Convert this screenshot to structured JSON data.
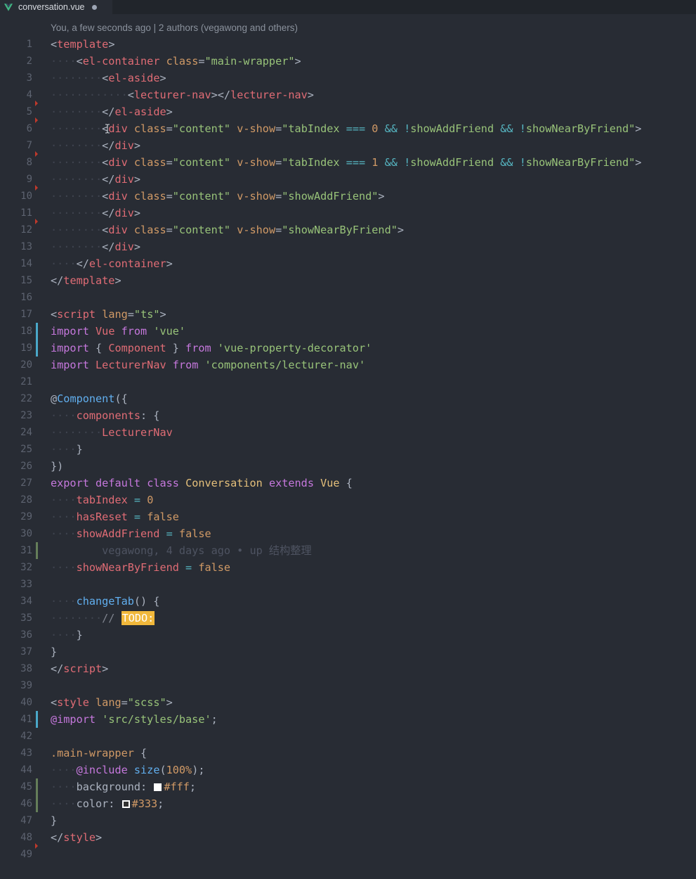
{
  "tab": {
    "filename": "conversation.vue",
    "icon": "vue-icon",
    "unsaved": true
  },
  "codelens": "You, a few seconds ago | 2 authors (vegawong and others)",
  "colors": {
    "background": "#282c34",
    "tag": "#e06c75",
    "attribute": "#d19a66",
    "string": "#98c379",
    "operator": "#56b6c2",
    "keyword": "#c678dd",
    "class": "#e5c07b",
    "function": "#61afef",
    "todo_highlight": "#f1b83b",
    "git_added": "#98c379",
    "git_modified": "#4aa8c9"
  },
  "lines": [
    {
      "n": "1",
      "ind": 0,
      "toks": [
        [
          "p",
          "<"
        ],
        [
          "tag",
          "template"
        ],
        [
          "p",
          ">"
        ]
      ]
    },
    {
      "n": "2",
      "ind": 1,
      "toks": [
        [
          "p",
          "<"
        ],
        [
          "tag",
          "el-container"
        ],
        [
          "p",
          " "
        ],
        [
          "attr",
          "class"
        ],
        [
          "p",
          "="
        ],
        [
          "str",
          "\"main-wrapper\""
        ],
        [
          "p",
          ">"
        ]
      ]
    },
    {
      "n": "3",
      "ind": 2,
      "toks": [
        [
          "p",
          "<"
        ],
        [
          "tag",
          "el-aside"
        ],
        [
          "p",
          ">"
        ]
      ]
    },
    {
      "n": "4",
      "ind": 3,
      "toks": [
        [
          "p",
          "<"
        ],
        [
          "tag",
          "lecturer-nav"
        ],
        [
          "p",
          "></"
        ],
        [
          "tag",
          "lecturer-nav"
        ],
        [
          "p",
          ">"
        ]
      ]
    },
    {
      "n": "5",
      "ind": 2,
      "red": true,
      "toks": [
        [
          "p",
          "</"
        ],
        [
          "tag",
          "el-aside"
        ],
        [
          "p",
          ">"
        ]
      ]
    },
    {
      "n": "6",
      "ind": 2,
      "red": true,
      "toks": [
        [
          "p",
          "<"
        ],
        [
          "tag",
          "div"
        ],
        [
          "p",
          " "
        ],
        [
          "attr",
          "class"
        ],
        [
          "p",
          "="
        ],
        [
          "str",
          "\"content\""
        ],
        [
          "p",
          " "
        ],
        [
          "attr",
          "v-show"
        ],
        [
          "p",
          "="
        ],
        [
          "str",
          "\"tabIndex "
        ],
        [
          "op",
          "==="
        ],
        [
          "str",
          " "
        ],
        [
          "num",
          "0"
        ],
        [
          "str",
          " "
        ],
        [
          "op",
          "&&"
        ],
        [
          "str",
          " "
        ],
        [
          "op",
          "!"
        ],
        [
          "str",
          "showAddFriend "
        ],
        [
          "op",
          "&&"
        ],
        [
          "str",
          " "
        ],
        [
          "op",
          "!"
        ],
        [
          "str",
          "showNearByFriend\""
        ],
        [
          "p",
          ">"
        ]
      ]
    },
    {
      "n": "7",
      "ind": 2,
      "toks": [
        [
          "p",
          "</"
        ],
        [
          "tag",
          "div"
        ],
        [
          "p",
          ">"
        ]
      ]
    },
    {
      "n": "8",
      "ind": 2,
      "red": true,
      "toks": [
        [
          "p",
          "<"
        ],
        [
          "tag",
          "div"
        ],
        [
          "p",
          " "
        ],
        [
          "attr",
          "class"
        ],
        [
          "p",
          "="
        ],
        [
          "str",
          "\"content\""
        ],
        [
          "p",
          " "
        ],
        [
          "attr",
          "v-show"
        ],
        [
          "p",
          "="
        ],
        [
          "str",
          "\"tabIndex "
        ],
        [
          "op",
          "==="
        ],
        [
          "str",
          " "
        ],
        [
          "num",
          "1"
        ],
        [
          "str",
          " "
        ],
        [
          "op",
          "&&"
        ],
        [
          "str",
          " "
        ],
        [
          "op",
          "!"
        ],
        [
          "str",
          "showAddFriend "
        ],
        [
          "op",
          "&&"
        ],
        [
          "str",
          " "
        ],
        [
          "op",
          "!"
        ],
        [
          "str",
          "showNearByFriend\""
        ],
        [
          "p",
          ">"
        ]
      ]
    },
    {
      "n": "9",
      "ind": 2,
      "toks": [
        [
          "p",
          "</"
        ],
        [
          "tag",
          "div"
        ],
        [
          "p",
          ">"
        ]
      ]
    },
    {
      "n": "10",
      "ind": 2,
      "red": true,
      "toks": [
        [
          "p",
          "<"
        ],
        [
          "tag",
          "div"
        ],
        [
          "p",
          " "
        ],
        [
          "attr",
          "class"
        ],
        [
          "p",
          "="
        ],
        [
          "str",
          "\"content\""
        ],
        [
          "p",
          " "
        ],
        [
          "attr",
          "v-show"
        ],
        [
          "p",
          "="
        ],
        [
          "str",
          "\"showAddFriend\""
        ],
        [
          "p",
          ">"
        ]
      ]
    },
    {
      "n": "11",
      "ind": 2,
      "toks": [
        [
          "p",
          "</"
        ],
        [
          "tag",
          "div"
        ],
        [
          "p",
          ">"
        ]
      ]
    },
    {
      "n": "12",
      "ind": 2,
      "red": true,
      "toks": [
        [
          "p",
          "<"
        ],
        [
          "tag",
          "div"
        ],
        [
          "p",
          " "
        ],
        [
          "attr",
          "class"
        ],
        [
          "p",
          "="
        ],
        [
          "str",
          "\"content\""
        ],
        [
          "p",
          " "
        ],
        [
          "attr",
          "v-show"
        ],
        [
          "p",
          "="
        ],
        [
          "str",
          "\"showNearByFriend\""
        ],
        [
          "p",
          ">"
        ]
      ]
    },
    {
      "n": "13",
      "ind": 2,
      "toks": [
        [
          "p",
          "</"
        ],
        [
          "tag",
          "div"
        ],
        [
          "p",
          ">"
        ]
      ]
    },
    {
      "n": "14",
      "ind": 1,
      "toks": [
        [
          "p",
          "</"
        ],
        [
          "tag",
          "el-container"
        ],
        [
          "p",
          ">"
        ]
      ]
    },
    {
      "n": "15",
      "ind": 0,
      "toks": [
        [
          "p",
          "</"
        ],
        [
          "tag",
          "template"
        ],
        [
          "p",
          ">"
        ]
      ]
    },
    {
      "n": "16",
      "ind": 0,
      "toks": []
    },
    {
      "n": "17",
      "ind": 0,
      "toks": [
        [
          "p",
          "<"
        ],
        [
          "tag",
          "script"
        ],
        [
          "p",
          " "
        ],
        [
          "attr",
          "lang"
        ],
        [
          "p",
          "="
        ],
        [
          "str",
          "\"ts\""
        ],
        [
          "p",
          ">"
        ]
      ]
    },
    {
      "n": "18",
      "ind": 0,
      "git": "mod",
      "toks": [
        [
          "kw",
          "import"
        ],
        [
          "p",
          " "
        ],
        [
          "prop",
          "Vue"
        ],
        [
          "p",
          " "
        ],
        [
          "kw",
          "from"
        ],
        [
          "p",
          " "
        ],
        [
          "str",
          "'vue'"
        ]
      ]
    },
    {
      "n": "19",
      "ind": 0,
      "git": "mod",
      "toks": [
        [
          "kw",
          "import"
        ],
        [
          "p",
          " { "
        ],
        [
          "prop",
          "Component"
        ],
        [
          "p",
          " } "
        ],
        [
          "kw",
          "from"
        ],
        [
          "p",
          " "
        ],
        [
          "str",
          "'vue-property-decorator'"
        ]
      ]
    },
    {
      "n": "20",
      "ind": 0,
      "toks": [
        [
          "kw",
          "import"
        ],
        [
          "p",
          " "
        ],
        [
          "prop",
          "LecturerNav"
        ],
        [
          "p",
          " "
        ],
        [
          "kw",
          "from"
        ],
        [
          "p",
          " "
        ],
        [
          "str",
          "'components/lecturer-nav'"
        ]
      ]
    },
    {
      "n": "21",
      "ind": 0,
      "toks": []
    },
    {
      "n": "22",
      "ind": 0,
      "toks": [
        [
          "p",
          "@"
        ],
        [
          "fn",
          "Component"
        ],
        [
          "p",
          "({"
        ]
      ]
    },
    {
      "n": "23",
      "ind": 1,
      "toks": [
        [
          "prop",
          "components"
        ],
        [
          "p",
          ": {"
        ]
      ]
    },
    {
      "n": "24",
      "ind": 2,
      "toks": [
        [
          "prop",
          "LecturerNav"
        ]
      ]
    },
    {
      "n": "25",
      "ind": 1,
      "toks": [
        [
          "p",
          "}"
        ]
      ]
    },
    {
      "n": "26",
      "ind": 0,
      "toks": [
        [
          "p",
          "})"
        ]
      ]
    },
    {
      "n": "27",
      "ind": 0,
      "toks": [
        [
          "kw",
          "export"
        ],
        [
          "p",
          " "
        ],
        [
          "kw",
          "default"
        ],
        [
          "p",
          " "
        ],
        [
          "kw",
          "class"
        ],
        [
          "p",
          " "
        ],
        [
          "cls",
          "Conversation"
        ],
        [
          "p",
          " "
        ],
        [
          "kw",
          "extends"
        ],
        [
          "p",
          " "
        ],
        [
          "cls",
          "Vue"
        ],
        [
          "p",
          " {"
        ]
      ]
    },
    {
      "n": "28",
      "ind": 1,
      "toks": [
        [
          "prop",
          "tabIndex"
        ],
        [
          "p",
          " "
        ],
        [
          "op",
          "="
        ],
        [
          "p",
          " "
        ],
        [
          "num",
          "0"
        ]
      ]
    },
    {
      "n": "29",
      "ind": 1,
      "toks": [
        [
          "prop",
          "hasReset"
        ],
        [
          "p",
          " "
        ],
        [
          "op",
          "="
        ],
        [
          "p",
          " "
        ],
        [
          "num",
          "false"
        ]
      ]
    },
    {
      "n": "30",
      "ind": 1,
      "toks": [
        [
          "prop",
          "showAddFriend"
        ],
        [
          "p",
          " "
        ],
        [
          "op",
          "="
        ],
        [
          "p",
          " "
        ],
        [
          "num",
          "false"
        ]
      ]
    },
    {
      "n": "31",
      "ind": 0,
      "git": "add",
      "toks": [
        [
          "blame",
          "        vegawong, 4 days ago • up 结构整理"
        ]
      ]
    },
    {
      "n": "32",
      "ind": 1,
      "toks": [
        [
          "prop",
          "showNearByFriend"
        ],
        [
          "p",
          " "
        ],
        [
          "op",
          "="
        ],
        [
          "p",
          " "
        ],
        [
          "num",
          "false"
        ]
      ]
    },
    {
      "n": "33",
      "ind": 0,
      "toks": []
    },
    {
      "n": "34",
      "ind": 1,
      "toks": [
        [
          "fn",
          "changeTab"
        ],
        [
          "p",
          "() {"
        ]
      ]
    },
    {
      "n": "35",
      "ind": 2,
      "toks": [
        [
          "comment",
          "// "
        ],
        [
          "todo",
          "TODO:"
        ]
      ]
    },
    {
      "n": "36",
      "ind": 1,
      "toks": [
        [
          "p",
          "}"
        ]
      ]
    },
    {
      "n": "37",
      "ind": 0,
      "toks": [
        [
          "p",
          "}"
        ]
      ]
    },
    {
      "n": "38",
      "ind": 0,
      "toks": [
        [
          "p",
          "</"
        ],
        [
          "tag",
          "script"
        ],
        [
          "p",
          ">"
        ]
      ]
    },
    {
      "n": "39",
      "ind": 0,
      "toks": []
    },
    {
      "n": "40",
      "ind": 0,
      "toks": [
        [
          "p",
          "<"
        ],
        [
          "tag",
          "style"
        ],
        [
          "p",
          " "
        ],
        [
          "attr",
          "lang"
        ],
        [
          "p",
          "="
        ],
        [
          "str",
          "\"scss\""
        ],
        [
          "p",
          ">"
        ]
      ]
    },
    {
      "n": "41",
      "ind": 0,
      "git": "mod",
      "toks": [
        [
          "kw",
          "@import"
        ],
        [
          "p",
          " "
        ],
        [
          "str",
          "'src/styles/base'"
        ],
        [
          "p",
          ";"
        ]
      ]
    },
    {
      "n": "42",
      "ind": 0,
      "toks": []
    },
    {
      "n": "43",
      "ind": 0,
      "toks": [
        [
          "attr",
          ".main-wrapper"
        ],
        [
          "p",
          " {"
        ]
      ]
    },
    {
      "n": "44",
      "ind": 1,
      "toks": [
        [
          "kw",
          "@include"
        ],
        [
          "p",
          " "
        ],
        [
          "fn",
          "size"
        ],
        [
          "p",
          "("
        ],
        [
          "num",
          "100%"
        ],
        [
          "p",
          ");"
        ]
      ]
    },
    {
      "n": "45",
      "ind": 1,
      "git": "add",
      "toks": [
        [
          "p",
          "background: "
        ],
        [
          "swatch",
          "white"
        ],
        [
          "num",
          "#fff"
        ],
        [
          "p",
          ";"
        ]
      ]
    },
    {
      "n": "46",
      "ind": 1,
      "git": "add",
      "toks": [
        [
          "p",
          "color: "
        ],
        [
          "swatch",
          "dark"
        ],
        [
          "num",
          "#333"
        ],
        [
          "p",
          ";"
        ]
      ]
    },
    {
      "n": "47",
      "ind": 0,
      "toks": [
        [
          "p",
          "}"
        ]
      ]
    },
    {
      "n": "48",
      "ind": 0,
      "toks": [
        [
          "p",
          "</"
        ],
        [
          "tag",
          "style"
        ],
        [
          "p",
          ">"
        ]
      ]
    },
    {
      "n": "49",
      "ind": 0,
      "red": true,
      "toks": []
    }
  ]
}
